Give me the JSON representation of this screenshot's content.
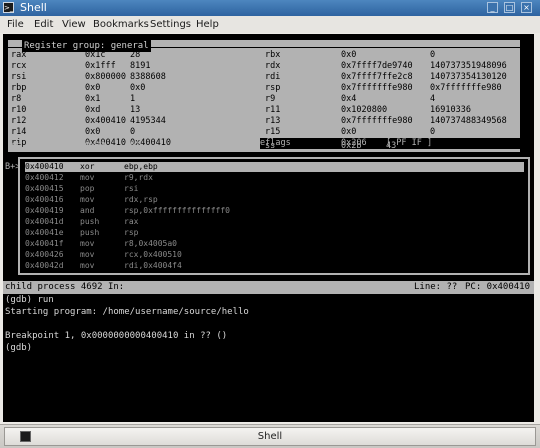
{
  "window": {
    "title": "Shell",
    "app_icon": "terminal-icon",
    "buttons": {
      "minimize": "_",
      "maximize": "□",
      "close": "×"
    }
  },
  "menu": [
    "File",
    "Edit",
    "View",
    "Bookmarks",
    "Settings",
    "Help"
  ],
  "registers": {
    "group_label": "Register group: general",
    "left": [
      {
        "name": "rax",
        "hex": "0x1c",
        "dec": "28"
      },
      {
        "name": "rcx",
        "hex": "0x1fff",
        "dec": "8191"
      },
      {
        "name": "rsi",
        "hex": "0x800000",
        "dec": "8388608"
      },
      {
        "name": "rbp",
        "hex": "0x0",
        "dec": "0x0"
      },
      {
        "name": "r8",
        "hex": "0x1",
        "dec": "1"
      },
      {
        "name": "r10",
        "hex": "0xd",
        "dec": "13"
      },
      {
        "name": "r12",
        "hex": "0x400410",
        "dec": "4195344"
      },
      {
        "name": "r14",
        "hex": "0x0",
        "dec": "0"
      },
      {
        "name": "rip",
        "hex": "0x400410",
        "dec": "0x400410"
      }
    ],
    "right": [
      {
        "name": "rbx",
        "hex": "0x0",
        "dec": "0"
      },
      {
        "name": "rdx",
        "hex": "0x7ffff7de9740",
        "dec": "140737351948096"
      },
      {
        "name": "rdi",
        "hex": "0x7ffff7ffe2c8",
        "dec": "140737354130120"
      },
      {
        "name": "rsp",
        "hex": "0x7fffffffe980",
        "dec": "0x7fffffffe980"
      },
      {
        "name": "r9",
        "hex": "0x4",
        "dec": "4"
      },
      {
        "name": "r11",
        "hex": "0x1020800",
        "dec": "16910336"
      },
      {
        "name": "r13",
        "hex": "0x7fffffffe980",
        "dec": "140737488349568"
      },
      {
        "name": "r15",
        "hex": "0x0",
        "dec": "0"
      }
    ],
    "eflags": {
      "name": "eflags",
      "hex": "0x206",
      "dec": "[ PF IF ]"
    },
    "cs": {
      "name": "cs",
      "hex": "0x33",
      "dec": "51"
    },
    "ss": {
      "name": "ss",
      "hex": "0x2b",
      "dec": "43"
    }
  },
  "asm": {
    "marker": "B+>",
    "rows": [
      {
        "addr": "0x400410",
        "op": "xor",
        "args": "ebp,ebp"
      },
      {
        "addr": "0x400412",
        "op": "mov",
        "args": "r9,rdx"
      },
      {
        "addr": "0x400415",
        "op": "pop",
        "args": "rsi"
      },
      {
        "addr": "0x400416",
        "op": "mov",
        "args": "rdx,rsp"
      },
      {
        "addr": "0x400419",
        "op": "and",
        "args": "rsp,0xfffffffffffffff0"
      },
      {
        "addr": "0x40041d",
        "op": "push",
        "args": "rax"
      },
      {
        "addr": "0x40041e",
        "op": "push",
        "args": "rsp"
      },
      {
        "addr": "0x40041f",
        "op": "mov",
        "args": "r8,0x4005a0"
      },
      {
        "addr": "0x400426",
        "op": "mov",
        "args": "rcx,0x400510"
      },
      {
        "addr": "0x40042d",
        "op": "mov",
        "args": "rdi,0x4004f4"
      }
    ]
  },
  "status": {
    "process": "child process 4692 In:",
    "line": "Line: ??",
    "pc": "PC: 0x400410"
  },
  "console": [
    "(gdb) run",
    "Starting program: /home/username/source/hello",
    "",
    "Breakpoint 1, 0x0000000000400410 in ?? ()",
    "(gdb)"
  ],
  "taskbar": {
    "label": "Shell",
    "icon": "terminal-icon"
  }
}
